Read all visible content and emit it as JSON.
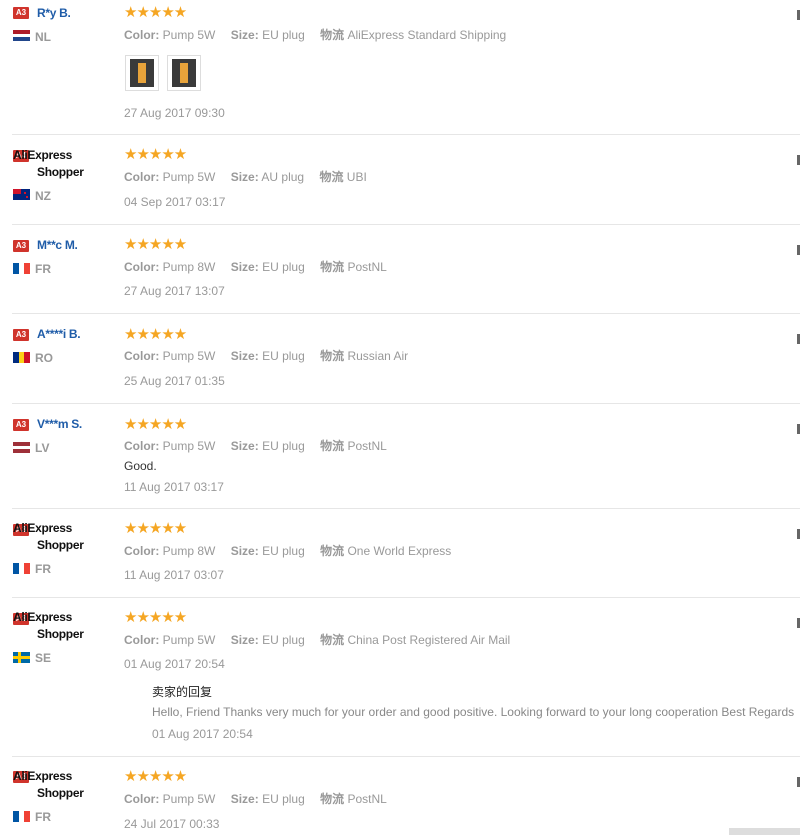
{
  "labels": {
    "color": "Color:",
    "size": "Size:",
    "shipping": "物流"
  },
  "colors": {
    "badge": "#d0342c",
    "link_name": "#1f5ca8",
    "stars": "#f5a623"
  },
  "reviews": [
    {
      "badge": "A3",
      "name": "R*y B.",
      "name_style": "link",
      "country": "NL",
      "flag": "nl",
      "stars": "★★★★★",
      "color": "Pump 5W",
      "size": "EU plug",
      "shipping": "AliExpress Standard Shipping",
      "date": "27 Aug 2017 09:30",
      "has_photos": true
    },
    {
      "badge": "A4",
      "name": "AliExpress Shopper",
      "name_style": "shopper",
      "country": "NZ",
      "flag": "nz",
      "stars": "★★★★★",
      "color": "Pump 5W",
      "size": "AU plug",
      "shipping": "UBI",
      "date": "04 Sep 2017 03:17"
    },
    {
      "badge": "A3",
      "name": "M**c M.",
      "name_style": "link",
      "country": "FR",
      "flag": "fr",
      "stars": "★★★★★",
      "color": "Pump 8W",
      "size": "EU plug",
      "shipping": "PostNL",
      "date": "27 Aug 2017 13:07"
    },
    {
      "badge": "A3",
      "name": "A****i B.",
      "name_style": "link",
      "country": "RO",
      "flag": "ro",
      "stars": "★★★★★",
      "color": "Pump 5W",
      "size": "EU plug",
      "shipping": "Russian Air",
      "date": "25 Aug 2017 01:35"
    },
    {
      "badge": "A3",
      "name": "V***m S.",
      "name_style": "link",
      "country": "LV",
      "flag": "lv",
      "stars": "★★★★★",
      "color": "Pump 5W",
      "size": "EU plug",
      "shipping": "PostNL",
      "feedback": "Good.",
      "date": "11 Aug 2017 03:17"
    },
    {
      "badge": "A3",
      "name": "AliExpress Shopper",
      "name_style": "shopper",
      "country": "FR",
      "flag": "fr",
      "stars": "★★★★★",
      "color": "Pump 8W",
      "size": "EU plug",
      "shipping": "One World Express",
      "date": "11 Aug 2017 03:07"
    },
    {
      "badge": "A3",
      "name": "AliExpress Shopper",
      "name_style": "shopper",
      "country": "SE",
      "flag": "se",
      "stars": "★★★★★",
      "color": "Pump 5W",
      "size": "EU plug",
      "shipping": "China Post Registered Air Mail",
      "date": "01 Aug 2017 20:54",
      "reply": {
        "title": "卖家的回复",
        "text": "Hello, Friend Thanks very much for your order and good positive. Looking forward to your long cooperation Best Regards",
        "date": "01 Aug 2017 20:54"
      }
    },
    {
      "badge": "A3",
      "name": "AliExpress Shopper",
      "name_style": "shopper",
      "country": "FR",
      "flag": "fr",
      "stars": "★★★★★",
      "color": "Pump 5W",
      "size": "EU plug",
      "shipping": "PostNL",
      "date": "24 Jul 2017 00:33"
    }
  ]
}
